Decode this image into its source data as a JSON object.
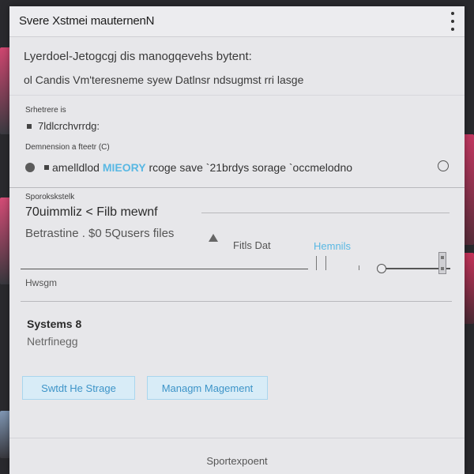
{
  "window": {
    "title": "Svere Xstmei mauternenN"
  },
  "description": {
    "line1": "Lyerdoel-Jetogcgj dis manogqevehs bytent:",
    "line2": "ol Candis Vm'teresneme syew Datlnsr ndsugmst rri lasge"
  },
  "section1": {
    "label": "Srhetrere is",
    "item_text": "7ldlcrchvrrdg:"
  },
  "section2": {
    "label": "Demnension a fteetr (C)",
    "storage_prefix": "amelldlod",
    "storage_accent": "MIEORY",
    "storage_suffix": "rcoge  save `21brdys sorage `occmelodno"
  },
  "section3": {
    "label": "Sporokskstelk",
    "big_line": "70uimmliz < Filb mewnf",
    "med_line": "Betrastine .  $0 5Qusers files",
    "filter_label": "Fitls Dat",
    "blue_label": "Hemnils",
    "footer_label": "Hwsgm"
  },
  "systems": {
    "heading": "Systems 8",
    "subtext": "Netrfinegg"
  },
  "buttons": {
    "primary": "Swtdt He Strage",
    "secondary": "Managm Magement"
  },
  "footer": {
    "text": "Sportexpoent"
  },
  "colors": {
    "accent": "#59b8e3",
    "button_bg": "#d8ecf7",
    "button_border": "#a9d6ee",
    "window_bg": "#e7e7ea"
  },
  "icons": {
    "menu": "kebab-menu-icon",
    "warning": "warning-icon"
  }
}
